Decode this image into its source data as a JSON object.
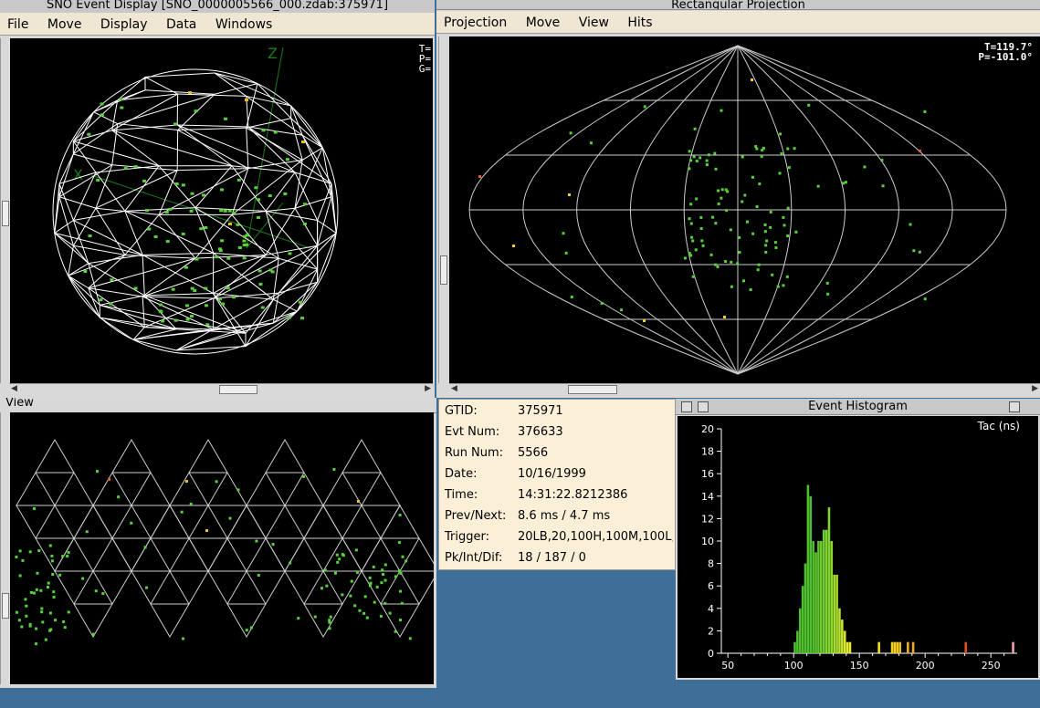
{
  "event_display": {
    "title": "SNO Event Display [SNO_0000005566_000.zdab:375971]",
    "menu": [
      "File",
      "Move",
      "Display",
      "Data",
      "Windows"
    ],
    "corner_labels": [
      "T=",
      "P=",
      "G="
    ]
  },
  "projection": {
    "title": "Rectangular Projection",
    "menu": [
      "Projection",
      "Move",
      "View",
      "Hits"
    ],
    "theta": "T=119.7°",
    "phi": "P=-101.0°"
  },
  "view_window": {
    "title": "View"
  },
  "event_info": {
    "rows": [
      {
        "label": "GTID:",
        "value": "375971"
      },
      {
        "label": "Evt Num:",
        "value": "376633"
      },
      {
        "label": "Run Num:",
        "value": "5566"
      },
      {
        "label": "Date:",
        "value": "10/16/1999"
      },
      {
        "label": "Time:",
        "value": "14:31:22.8212386"
      },
      {
        "label": "Prev/Next:",
        "value": "8.6 ms / 4.7 ms"
      },
      {
        "label": "Trigger:",
        "value": "20LB,20,100H,100M,100L,"
      },
      {
        "label": "Pk/Int/Dif:",
        "value": "18 / 187 / 0"
      }
    ]
  },
  "histogram": {
    "title": "Event Histogram",
    "label": "Tac (ns)"
  },
  "chart_data": {
    "type": "bar",
    "title": "Event Histogram",
    "xlabel": "Tac (ns)",
    "ylabel": "",
    "xlim": [
      45,
      270
    ],
    "ylim": [
      0,
      20
    ],
    "x_ticks": [
      50,
      100,
      150,
      200,
      250
    ],
    "y_ticks": [
      0,
      2,
      4,
      6,
      8,
      10,
      12,
      14,
      16,
      18,
      20
    ],
    "bin_width": 2,
    "bins": [
      {
        "x": 100,
        "count": 1,
        "color": "#4fbf2f"
      },
      {
        "x": 102,
        "count": 2,
        "color": "#4fbf2f"
      },
      {
        "x": 104,
        "count": 4,
        "color": "#4fbf2f"
      },
      {
        "x": 106,
        "count": 6,
        "color": "#4fbf2f"
      },
      {
        "x": 108,
        "count": 8,
        "color": "#4fbf2f"
      },
      {
        "x": 110,
        "count": 15,
        "color": "#4fbf2f"
      },
      {
        "x": 112,
        "count": 14,
        "color": "#4fbf2f"
      },
      {
        "x": 114,
        "count": 10,
        "color": "#4fbf2f"
      },
      {
        "x": 116,
        "count": 9,
        "color": "#5fc52f"
      },
      {
        "x": 118,
        "count": 10,
        "color": "#5fc52f"
      },
      {
        "x": 120,
        "count": 10,
        "color": "#6fcc2f"
      },
      {
        "x": 122,
        "count": 11,
        "color": "#6fcc2f"
      },
      {
        "x": 124,
        "count": 11,
        "color": "#7fd22f"
      },
      {
        "x": 126,
        "count": 13,
        "color": "#7fd22f"
      },
      {
        "x": 128,
        "count": 10,
        "color": "#8fd82f"
      },
      {
        "x": 130,
        "count": 7,
        "color": "#9fdc2f"
      },
      {
        "x": 132,
        "count": 7,
        "color": "#a8dc2f"
      },
      {
        "x": 134,
        "count": 4,
        "color": "#b8e02f"
      },
      {
        "x": 136,
        "count": 3,
        "color": "#c8e42f"
      },
      {
        "x": 138,
        "count": 2,
        "color": "#d8e82f"
      },
      {
        "x": 140,
        "count": 1,
        "color": "#e0e82f"
      },
      {
        "x": 142,
        "count": 1,
        "color": "#e8e82f"
      },
      {
        "x": 164,
        "count": 1,
        "color": "#f0e020"
      },
      {
        "x": 174,
        "count": 1,
        "color": "#f0d020"
      },
      {
        "x": 176,
        "count": 1,
        "color": "#f0d020"
      },
      {
        "x": 178,
        "count": 1,
        "color": "#f0c820"
      },
      {
        "x": 180,
        "count": 1,
        "color": "#f0c020"
      },
      {
        "x": 186,
        "count": 1,
        "color": "#f0b020"
      },
      {
        "x": 190,
        "count": 1,
        "color": "#f0a820"
      },
      {
        "x": 230,
        "count": 1,
        "color": "#e05020"
      },
      {
        "x": 266,
        "count": 1,
        "color": "#f0a0b0"
      }
    ]
  }
}
